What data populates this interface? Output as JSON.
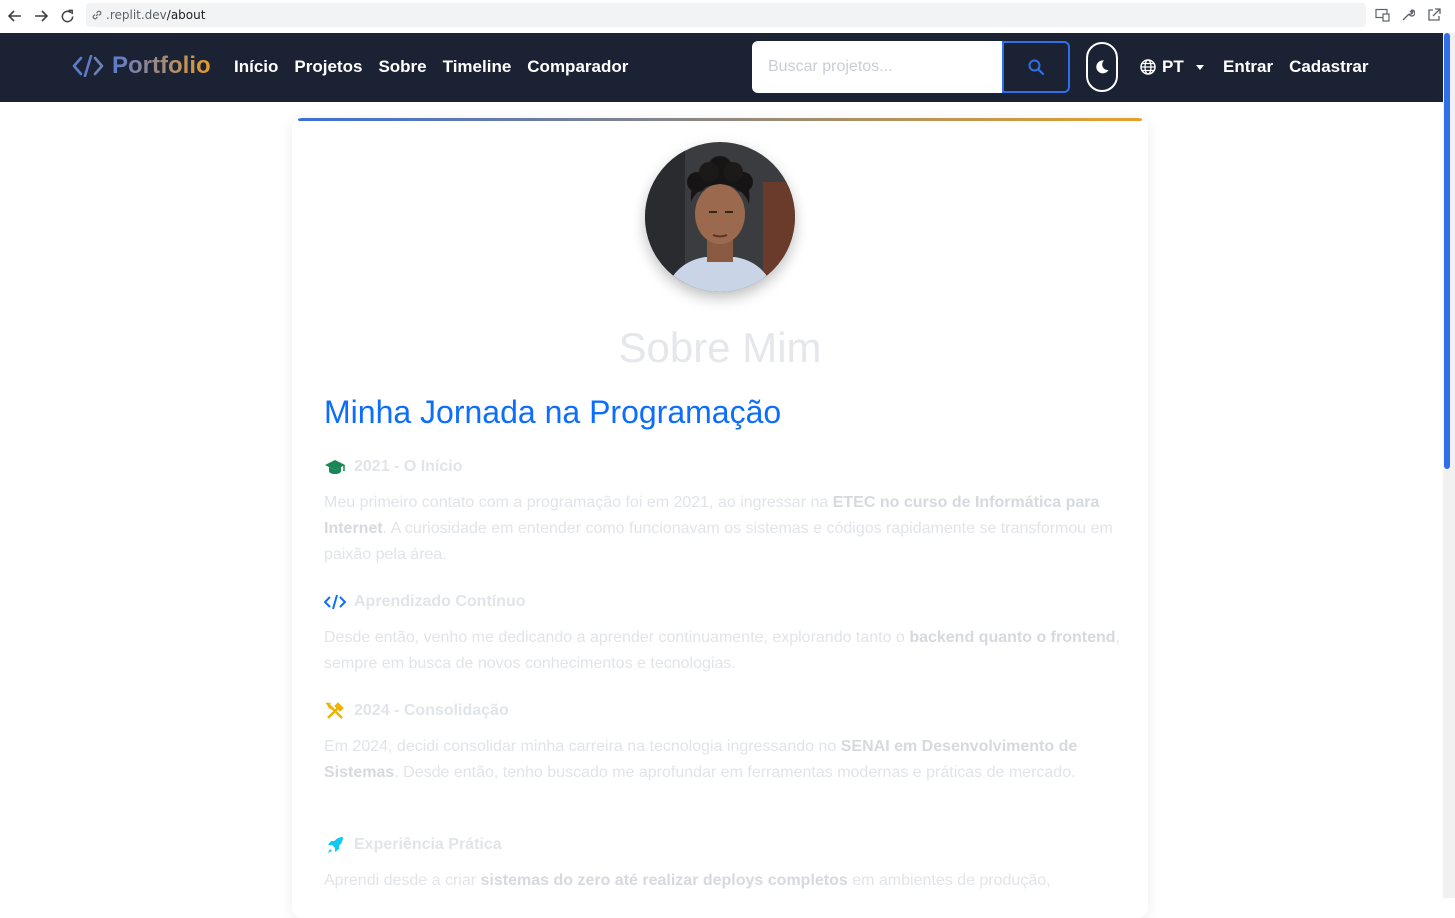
{
  "browser": {
    "url_host": ".replit.dev",
    "url_path": "/about"
  },
  "navbar": {
    "brand": "Portfolio",
    "links": [
      "Início",
      "Projetos",
      "Sobre",
      "Timeline",
      "Comparador"
    ],
    "search_placeholder": "Buscar projetos...",
    "language": "PT",
    "login": "Entrar",
    "signup": "Cadastrar"
  },
  "about": {
    "title": "Sobre Mim",
    "subtitle": "Minha Jornada na Programação",
    "sections": [
      {
        "icon": "graduation-cap-icon",
        "heading": "2021 - O Início",
        "body_pre": "Meu primeiro contato com a programação foi em 2021, ao ingressar na ",
        "body_bold": "ETEC no curso de Informática para Internet",
        "body_post": ". A curiosidade em entender como funcionavam os sistemas e códigos rapidamente se transformou em paixão pela área."
      },
      {
        "icon": "code-icon",
        "heading": "Aprendizado Contínuo",
        "body_pre": "Desde então, venho me dedicando a aprender continuamente, explorando tanto o ",
        "body_bold": "backend quanto o frontend",
        "body_post": ", sempre em busca de novos conhecimentos e tecnologias."
      },
      {
        "icon": "tools-icon",
        "heading": "2024 - Consolidação",
        "body_pre": "Em 2024, decidi consolidar minha carreira na tecnologia ingressando no ",
        "body_bold": "SENAI em Desenvolvimento de Sistemas",
        "body_post": ". Desde então, tenho buscado me aprofundar em ferramentas modernas e práticas de mercado."
      },
      {
        "icon": "rocket-icon",
        "heading": "Experiência Prática",
        "body_pre": "Aprendi desde a criar ",
        "body_bold": "sistemas do zero até realizar deploys completos",
        "body_post": " em ambientes de produção,"
      }
    ]
  },
  "colors": {
    "navbar_bg": "#1b2234",
    "accent_blue": "#0d6efd",
    "accent_orange": "#e6a02a"
  }
}
